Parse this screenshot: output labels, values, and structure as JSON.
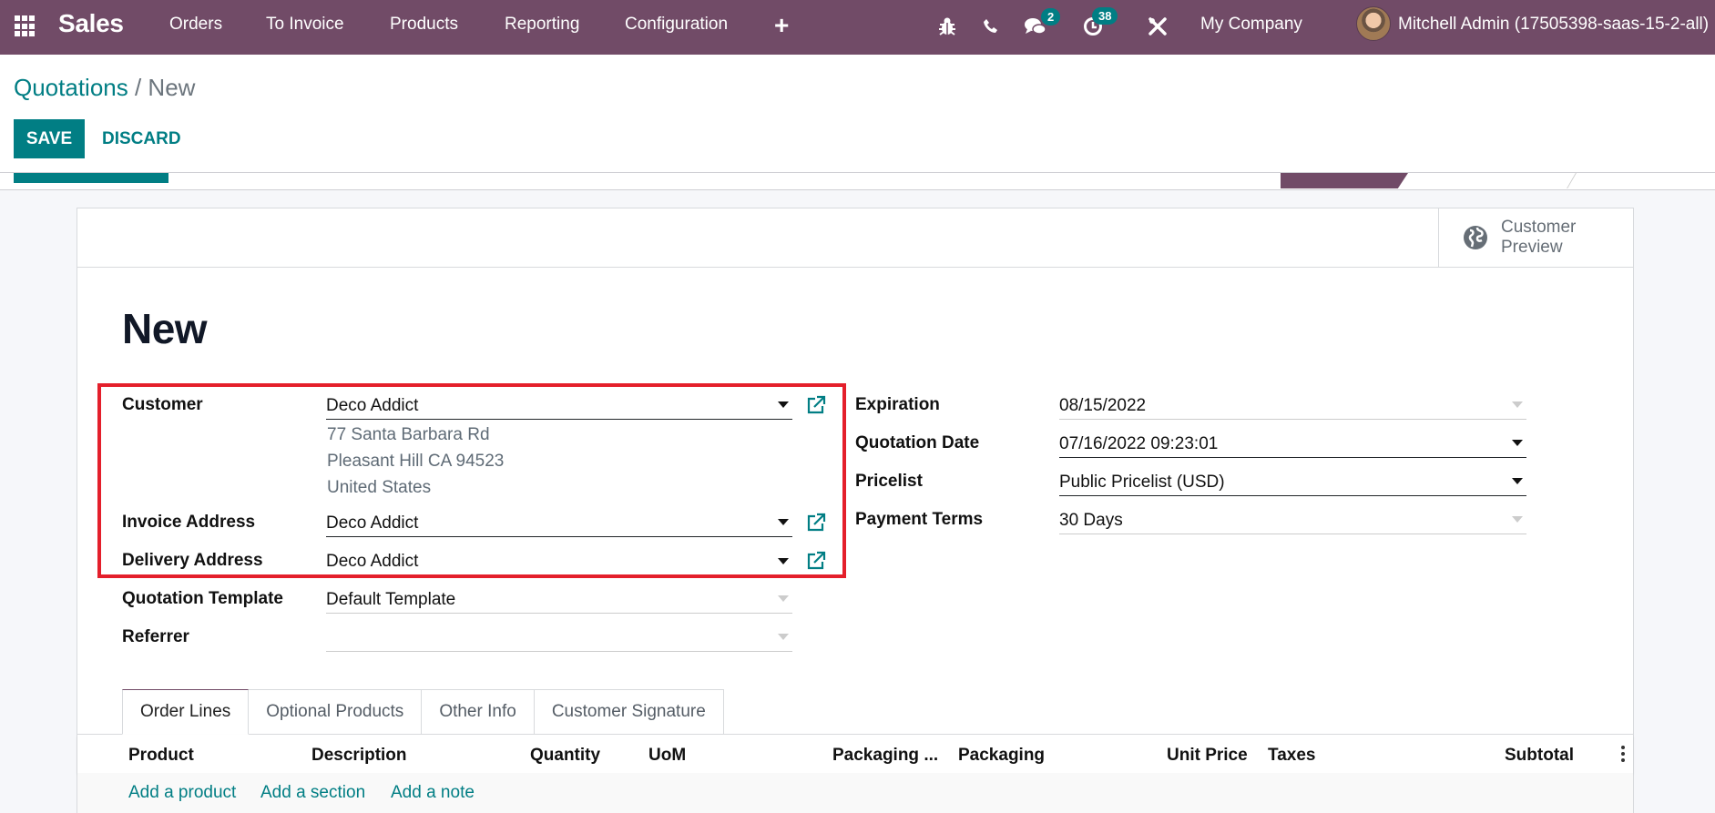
{
  "navbar": {
    "app_name": "Sales",
    "menu": [
      "Orders",
      "To Invoice",
      "Products",
      "Reporting",
      "Configuration"
    ],
    "plus_label": "+",
    "messages_badge": "2",
    "activities_badge": "38",
    "company": "My Company",
    "user": "Mitchell Admin (17505398-saas-15-2-all)",
    "brand_color": "#714b67"
  },
  "control_panel": {
    "breadcrumb_parent": "Quotations",
    "breadcrumb_separator": " / ",
    "breadcrumb_current": "New",
    "save_label": "SAVE",
    "discard_label": "DISCARD",
    "accent_color": "#017e84"
  },
  "sheet": {
    "customer_preview_line1": "Customer",
    "customer_preview_line2": "Preview",
    "title": "New",
    "left_fields": {
      "customer_label": "Customer",
      "customer_value": "Deco Addict",
      "customer_address": [
        "77 Santa Barbara Rd",
        "Pleasant Hill CA 94523",
        "United States"
      ],
      "invoice_label": "Invoice Address",
      "invoice_value": "Deco Addict",
      "delivery_label": "Delivery Address",
      "delivery_value": "Deco Addict",
      "template_label": "Quotation Template",
      "template_value": "Default Template",
      "referrer_label": "Referrer",
      "referrer_value": ""
    },
    "right_fields": {
      "expiration_label": "Expiration",
      "expiration_value": "08/15/2022",
      "quotation_date_label": "Quotation Date",
      "quotation_date_value": "07/16/2022 09:23:01",
      "pricelist_label": "Pricelist",
      "pricelist_value": "Public Pricelist (USD)",
      "payment_terms_label": "Payment Terms",
      "payment_terms_value": "30 Days"
    },
    "tabs": [
      "Order Lines",
      "Optional Products",
      "Other Info",
      "Customer Signature"
    ],
    "active_tab": "Order Lines",
    "columns": [
      "Product",
      "Description",
      "Quantity",
      "UoM",
      "Packaging ...",
      "Packaging",
      "Unit Price",
      "Taxes",
      "Subtotal"
    ],
    "add_links": [
      "Add a product",
      "Add a section",
      "Add a note"
    ],
    "highlight_color": "#e41f2b"
  }
}
